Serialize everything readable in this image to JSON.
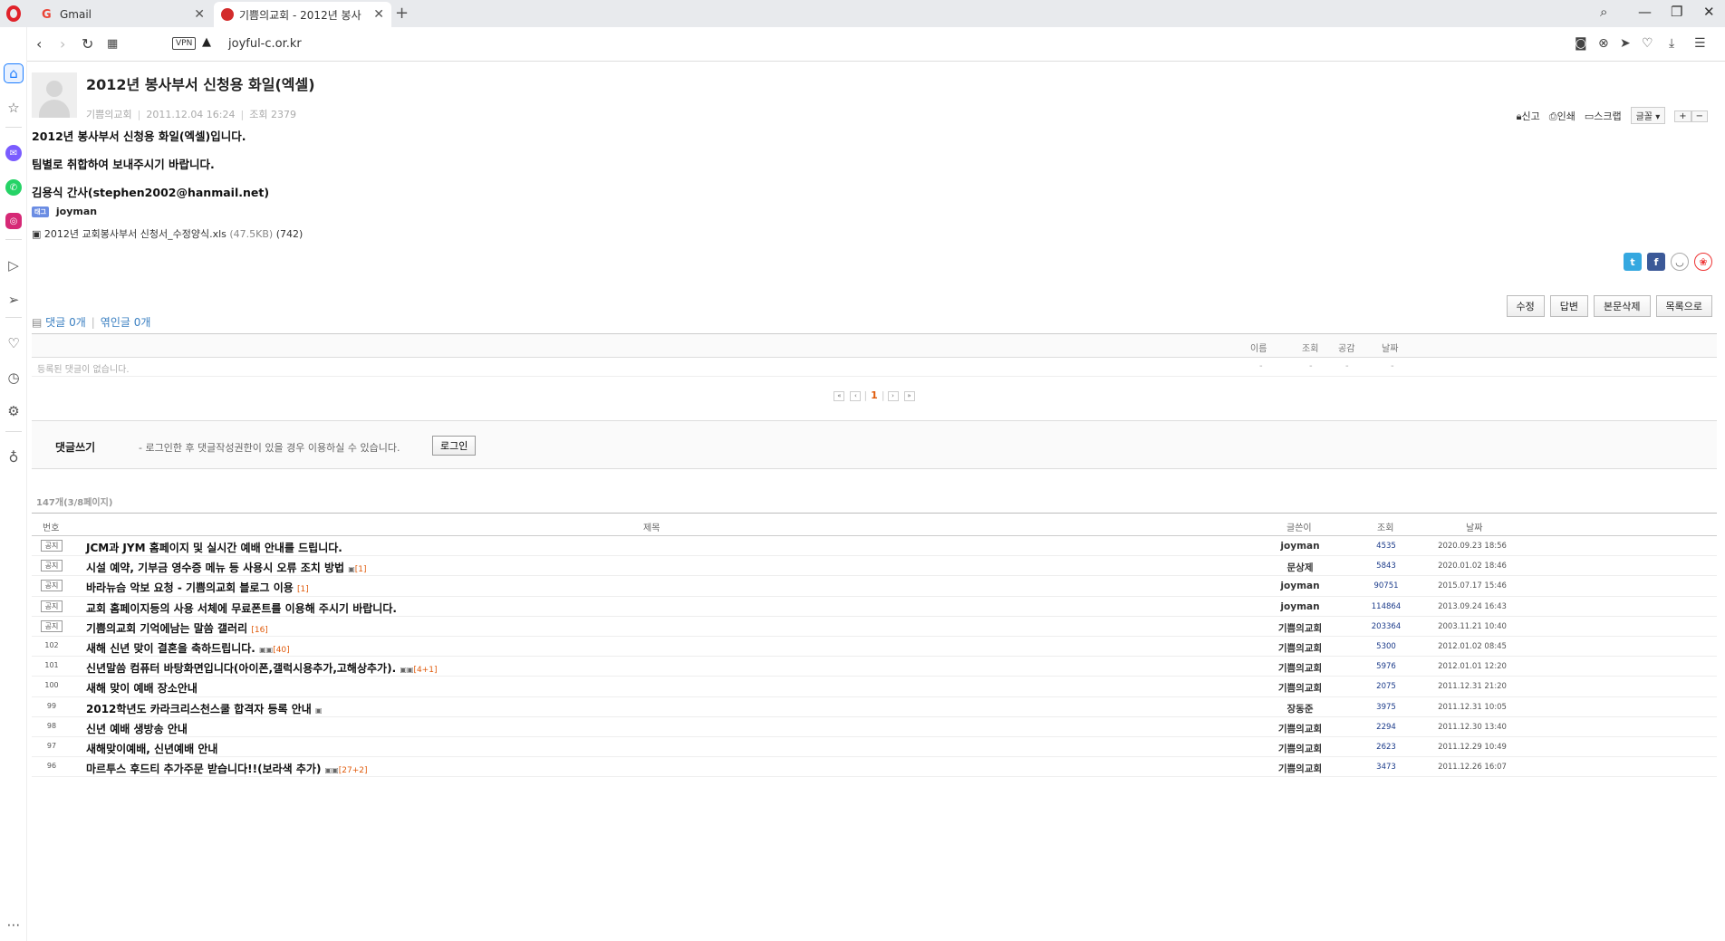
{
  "browser": {
    "tabs": [
      {
        "label": "Gmail",
        "active": false
      },
      {
        "label": "기쁨의교회 - 2012년 봉사",
        "active": true
      }
    ],
    "url": "joyful-c.or.kr",
    "vpn_label": "VPN"
  },
  "post": {
    "title": "2012년 봉사부서 신청용 화일(엑셀)",
    "author": "기쁨의교회",
    "datetime": "2011.12.04 16:24",
    "views_label": "조회 2379",
    "tools": {
      "report": "신고",
      "print": "인쇄",
      "scrap": "스크랩",
      "font": "글꼴",
      "plus": "+",
      "minus": "−"
    },
    "body": [
      "2012년 봉사부서 신청용 화일(엑셀)입니다.",
      "팀별로 취합하여 보내주시기 바랍니다.",
      "김용식 간사(stephen2002@hanmail.net)"
    ],
    "tag_icon": "태그",
    "tag": "joyman",
    "attachment": {
      "name": "2012년 교회봉사부서 신청서_수정양식.xls",
      "size": "(47.5KB)",
      "downloads": "(742)"
    },
    "actions": {
      "edit": "수정",
      "reply": "답변",
      "delete": "본문삭제",
      "list": "목록으로"
    }
  },
  "comments": {
    "comment_count": "댓글 0개",
    "trackback_count": "엮인글 0개",
    "headers": {
      "name": "이름",
      "views": "조회",
      "likes": "공감",
      "date": "날짜"
    },
    "empty_text": "등록된 댓글이 없습니다.",
    "dash": "-",
    "current_page": "1",
    "write_label": "댓글쓰기",
    "write_info": "- 로그인한 후 댓글작성권한이 있을 경우 이용하실 수 있습니다.",
    "login_button": "로그인"
  },
  "list": {
    "summary": "147개(3/8페이지)",
    "headers": {
      "no": "번호",
      "title": "제목",
      "author": "글쓴이",
      "views": "조회",
      "date": "날짜"
    },
    "rows": [
      {
        "no": "공지",
        "notice": true,
        "title": "JCM과 JYM 홈페이지 및 실시간 예배 안내를 드립니다.",
        "files": "",
        "count": "",
        "author": "joyman",
        "views": "4535",
        "date": "2020.09.23 18:56"
      },
      {
        "no": "공지",
        "notice": true,
        "title": "시설 예약, 기부금 영수증 메뉴 등 사용시 오류 조치 방법",
        "files": "▣",
        "count": "[1]",
        "author": "문상제",
        "views": "5843",
        "date": "2020.01.02 18:46"
      },
      {
        "no": "공지",
        "notice": true,
        "title": "바라뉴슴 악보 요청 - 기쁨의교회 블로그 이용",
        "files": "",
        "count": "[1]",
        "author": "joyman",
        "views": "90751",
        "date": "2015.07.17 15:46"
      },
      {
        "no": "공지",
        "notice": true,
        "title": "교회 홈페이지등의 사용 서체에 무료폰트를 이용해 주시기 바랍니다.",
        "files": "",
        "count": "",
        "author": "joyman",
        "views": "114864",
        "date": "2013.09.24 16:43"
      },
      {
        "no": "공지",
        "notice": true,
        "title": "기쁨의교회 기억에남는 말씀 갤러리",
        "files": "",
        "count": "[16]",
        "author": "기쁨의교회",
        "views": "203364",
        "date": "2003.11.21 10:40"
      },
      {
        "no": "102",
        "notice": false,
        "title": "새해 신년 맞이 결혼을 축하드립니다.",
        "files": "▣▣",
        "count": "[40]",
        "author": "기쁨의교회",
        "views": "5300",
        "date": "2012.01.02 08:45"
      },
      {
        "no": "101",
        "notice": false,
        "title": "신년말씀 컴퓨터 바탕화면입니다(아이폰,갤럭시용추가,고해상추가).",
        "files": "▣▣",
        "count": "[4+1]",
        "author": "기쁨의교회",
        "views": "5976",
        "date": "2012.01.01 12:20"
      },
      {
        "no": "100",
        "notice": false,
        "title": "새해 맞이 예배 장소안내",
        "files": "",
        "count": "",
        "author": "기쁨의교회",
        "views": "2075",
        "date": "2011.12.31 21:20"
      },
      {
        "no": "99",
        "notice": false,
        "title": "2012학년도 카라크리스천스쿨 합격자 등록 안내",
        "files": "▣",
        "count": "",
        "author": "장동준",
        "views": "3975",
        "date": "2011.12.31 10:05"
      },
      {
        "no": "98",
        "notice": false,
        "title": "신년 예배 생방송 안내",
        "files": "",
        "count": "",
        "author": "기쁨의교회",
        "views": "2294",
        "date": "2011.12.30 13:40"
      },
      {
        "no": "97",
        "notice": false,
        "title": "새해맞이예배, 신년예배 안내",
        "files": "",
        "count": "",
        "author": "기쁨의교회",
        "views": "2623",
        "date": "2011.12.29 10:49"
      },
      {
        "no": "96",
        "notice": false,
        "title": "마르투스 후드티 추가주문 받습니다!!(보라색 추가)",
        "files": "▣▣",
        "count": "[27+2]",
        "author": "기쁨의교회",
        "views": "3473",
        "date": "2011.12.26 16:07"
      }
    ]
  }
}
